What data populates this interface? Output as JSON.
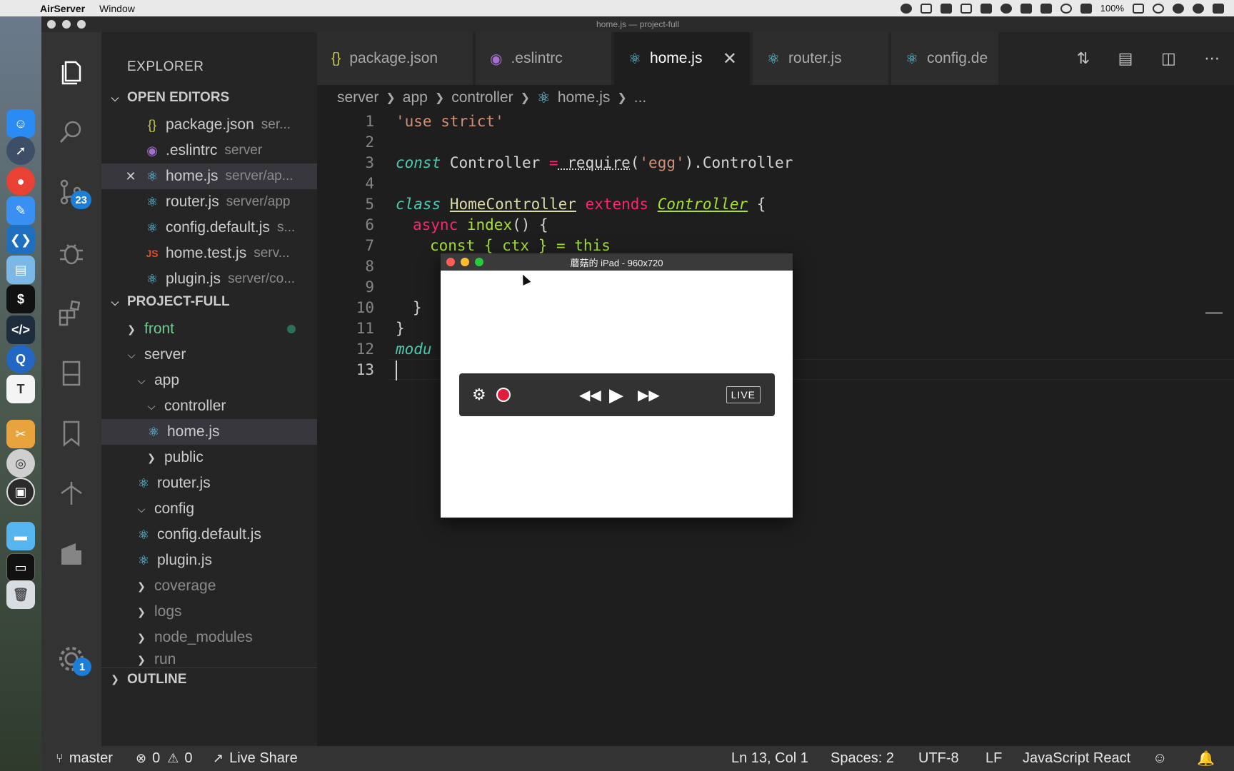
{
  "menubar": {
    "apple": "",
    "app_name": "AirServer",
    "menus": [
      "Window"
    ],
    "battery": "100%"
  },
  "window": {
    "title": "home.js — project-full"
  },
  "activity_bar": {
    "scm_badge": "23",
    "settings_badge": "1"
  },
  "sidebar": {
    "title": "EXPLORER",
    "open_editors_label": "OPEN EDITORS",
    "open_editors": [
      {
        "name": "package.json",
        "desc": "ser...",
        "icon": "json-icon"
      },
      {
        "name": ".eslintrc",
        "desc": "server",
        "icon": "eslint-icon"
      },
      {
        "name": "home.js",
        "desc": "server/ap...",
        "icon": "react-icon",
        "close": "✕"
      },
      {
        "name": "router.js",
        "desc": "server/app",
        "icon": "react-icon"
      },
      {
        "name": "config.default.js",
        "desc": "s...",
        "icon": "react-icon"
      },
      {
        "name": "home.test.js",
        "desc": "serv...",
        "icon": "js-icon"
      },
      {
        "name": "plugin.js",
        "desc": "server/co...",
        "icon": "react-icon"
      }
    ],
    "project_label": "PROJECT-FULL",
    "tree": [
      {
        "name": "front",
        "type": "folder"
      },
      {
        "name": "server",
        "type": "folder"
      },
      {
        "name": "app",
        "type": "folder"
      },
      {
        "name": "controller",
        "type": "folder"
      },
      {
        "name": "home.js",
        "type": "file"
      },
      {
        "name": "public",
        "type": "folder"
      },
      {
        "name": "router.js",
        "type": "file"
      },
      {
        "name": "config",
        "type": "folder"
      },
      {
        "name": "config.default.js",
        "type": "file"
      },
      {
        "name": "plugin.js",
        "type": "file"
      },
      {
        "name": "coverage",
        "type": "folder"
      },
      {
        "name": "logs",
        "type": "folder"
      },
      {
        "name": "node_modules",
        "type": "folder"
      },
      {
        "name": "run",
        "type": "folder"
      }
    ],
    "outline_label": "OUTLINE"
  },
  "tabs": [
    {
      "label": "package.json",
      "icon": "{}"
    },
    {
      "label": ".eslintrc",
      "icon": "◉"
    },
    {
      "label": "home.js",
      "icon": "⚛",
      "close": "✕"
    },
    {
      "label": "router.js",
      "icon": "⚛"
    },
    {
      "label": "config.de",
      "icon": "⚛"
    }
  ],
  "breadcrumb": {
    "parts": [
      "server",
      "app",
      "controller",
      "home.js",
      "..."
    ]
  },
  "editor": {
    "line_numbers": [
      "1",
      "2",
      "3",
      "4",
      "5",
      "6",
      "7",
      "8",
      "9",
      "10",
      "11",
      "12",
      "13"
    ],
    "l1": "'use strict'",
    "l3_kw": "const",
    "l3_name": " Controller ",
    "l3_eq": "=",
    "l3_req": " require",
    "l3_p1": "(",
    "l3_str": "'egg'",
    "l3_rest": ").Controller",
    "l5_kw": "class",
    "l5_cls": "HomeController",
    "l5_ext": "extends",
    "l5_base": "Controller",
    "l5_brace": " {",
    "l6_async": "async",
    "l6_fn": "index",
    "l6_rest": "() {",
    "l7_partial": "const { ctx } = this",
    "l10": "}",
    "l11": "}",
    "l12": "modu"
  },
  "airserver": {
    "title": "蘑菇的 iPad - 960x720",
    "live": "LIVE"
  },
  "statusbar": {
    "branch": "master",
    "errors": "0",
    "warnings": "0",
    "live_share": "Live Share",
    "position": "Ln 13, Col 1",
    "spaces": "Spaces: 2",
    "encoding": "UTF-8",
    "eol": "LF",
    "language": "JavaScript React"
  }
}
